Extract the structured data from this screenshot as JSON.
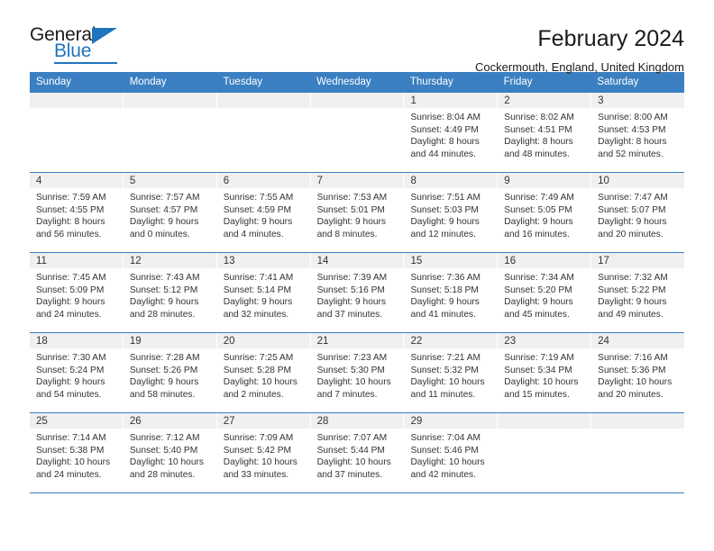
{
  "brand": {
    "name_top": "General",
    "name_bottom": "Blue",
    "accent_color": "#1f74bd"
  },
  "header": {
    "title": "February 2024",
    "subtitle": "Cockermouth, England, United Kingdom"
  },
  "theme": {
    "header_row_bg": "#3a7fc1",
    "date_band_bg": "#f0f0f0",
    "text_color": "#333333"
  },
  "weekdays": [
    "Sunday",
    "Monday",
    "Tuesday",
    "Wednesday",
    "Thursday",
    "Friday",
    "Saturday"
  ],
  "labels": {
    "sunrise": "Sunrise:",
    "sunset": "Sunset:",
    "daylight": "Daylight:"
  },
  "weeks": [
    [
      {
        "day": "",
        "empty": true
      },
      {
        "day": "",
        "empty": true
      },
      {
        "day": "",
        "empty": true
      },
      {
        "day": "",
        "empty": true
      },
      {
        "day": "1",
        "sunrise": "Sunrise: 8:04 AM",
        "sunset": "Sunset: 4:49 PM",
        "daylight1": "Daylight: 8 hours",
        "daylight2": "and 44 minutes."
      },
      {
        "day": "2",
        "sunrise": "Sunrise: 8:02 AM",
        "sunset": "Sunset: 4:51 PM",
        "daylight1": "Daylight: 8 hours",
        "daylight2": "and 48 minutes."
      },
      {
        "day": "3",
        "sunrise": "Sunrise: 8:00 AM",
        "sunset": "Sunset: 4:53 PM",
        "daylight1": "Daylight: 8 hours",
        "daylight2": "and 52 minutes."
      }
    ],
    [
      {
        "day": "4",
        "sunrise": "Sunrise: 7:59 AM",
        "sunset": "Sunset: 4:55 PM",
        "daylight1": "Daylight: 8 hours",
        "daylight2": "and 56 minutes."
      },
      {
        "day": "5",
        "sunrise": "Sunrise: 7:57 AM",
        "sunset": "Sunset: 4:57 PM",
        "daylight1": "Daylight: 9 hours",
        "daylight2": "and 0 minutes."
      },
      {
        "day": "6",
        "sunrise": "Sunrise: 7:55 AM",
        "sunset": "Sunset: 4:59 PM",
        "daylight1": "Daylight: 9 hours",
        "daylight2": "and 4 minutes."
      },
      {
        "day": "7",
        "sunrise": "Sunrise: 7:53 AM",
        "sunset": "Sunset: 5:01 PM",
        "daylight1": "Daylight: 9 hours",
        "daylight2": "and 8 minutes."
      },
      {
        "day": "8",
        "sunrise": "Sunrise: 7:51 AM",
        "sunset": "Sunset: 5:03 PM",
        "daylight1": "Daylight: 9 hours",
        "daylight2": "and 12 minutes."
      },
      {
        "day": "9",
        "sunrise": "Sunrise: 7:49 AM",
        "sunset": "Sunset: 5:05 PM",
        "daylight1": "Daylight: 9 hours",
        "daylight2": "and 16 minutes."
      },
      {
        "day": "10",
        "sunrise": "Sunrise: 7:47 AM",
        "sunset": "Sunset: 5:07 PM",
        "daylight1": "Daylight: 9 hours",
        "daylight2": "and 20 minutes."
      }
    ],
    [
      {
        "day": "11",
        "sunrise": "Sunrise: 7:45 AM",
        "sunset": "Sunset: 5:09 PM",
        "daylight1": "Daylight: 9 hours",
        "daylight2": "and 24 minutes."
      },
      {
        "day": "12",
        "sunrise": "Sunrise: 7:43 AM",
        "sunset": "Sunset: 5:12 PM",
        "daylight1": "Daylight: 9 hours",
        "daylight2": "and 28 minutes."
      },
      {
        "day": "13",
        "sunrise": "Sunrise: 7:41 AM",
        "sunset": "Sunset: 5:14 PM",
        "daylight1": "Daylight: 9 hours",
        "daylight2": "and 32 minutes."
      },
      {
        "day": "14",
        "sunrise": "Sunrise: 7:39 AM",
        "sunset": "Sunset: 5:16 PM",
        "daylight1": "Daylight: 9 hours",
        "daylight2": "and 37 minutes."
      },
      {
        "day": "15",
        "sunrise": "Sunrise: 7:36 AM",
        "sunset": "Sunset: 5:18 PM",
        "daylight1": "Daylight: 9 hours",
        "daylight2": "and 41 minutes."
      },
      {
        "day": "16",
        "sunrise": "Sunrise: 7:34 AM",
        "sunset": "Sunset: 5:20 PM",
        "daylight1": "Daylight: 9 hours",
        "daylight2": "and 45 minutes."
      },
      {
        "day": "17",
        "sunrise": "Sunrise: 7:32 AM",
        "sunset": "Sunset: 5:22 PM",
        "daylight1": "Daylight: 9 hours",
        "daylight2": "and 49 minutes."
      }
    ],
    [
      {
        "day": "18",
        "sunrise": "Sunrise: 7:30 AM",
        "sunset": "Sunset: 5:24 PM",
        "daylight1": "Daylight: 9 hours",
        "daylight2": "and 54 minutes."
      },
      {
        "day": "19",
        "sunrise": "Sunrise: 7:28 AM",
        "sunset": "Sunset: 5:26 PM",
        "daylight1": "Daylight: 9 hours",
        "daylight2": "and 58 minutes."
      },
      {
        "day": "20",
        "sunrise": "Sunrise: 7:25 AM",
        "sunset": "Sunset: 5:28 PM",
        "daylight1": "Daylight: 10 hours",
        "daylight2": "and 2 minutes."
      },
      {
        "day": "21",
        "sunrise": "Sunrise: 7:23 AM",
        "sunset": "Sunset: 5:30 PM",
        "daylight1": "Daylight: 10 hours",
        "daylight2": "and 7 minutes."
      },
      {
        "day": "22",
        "sunrise": "Sunrise: 7:21 AM",
        "sunset": "Sunset: 5:32 PM",
        "daylight1": "Daylight: 10 hours",
        "daylight2": "and 11 minutes."
      },
      {
        "day": "23",
        "sunrise": "Sunrise: 7:19 AM",
        "sunset": "Sunset: 5:34 PM",
        "daylight1": "Daylight: 10 hours",
        "daylight2": "and 15 minutes."
      },
      {
        "day": "24",
        "sunrise": "Sunrise: 7:16 AM",
        "sunset": "Sunset: 5:36 PM",
        "daylight1": "Daylight: 10 hours",
        "daylight2": "and 20 minutes."
      }
    ],
    [
      {
        "day": "25",
        "sunrise": "Sunrise: 7:14 AM",
        "sunset": "Sunset: 5:38 PM",
        "daylight1": "Daylight: 10 hours",
        "daylight2": "and 24 minutes."
      },
      {
        "day": "26",
        "sunrise": "Sunrise: 7:12 AM",
        "sunset": "Sunset: 5:40 PM",
        "daylight1": "Daylight: 10 hours",
        "daylight2": "and 28 minutes."
      },
      {
        "day": "27",
        "sunrise": "Sunrise: 7:09 AM",
        "sunset": "Sunset: 5:42 PM",
        "daylight1": "Daylight: 10 hours",
        "daylight2": "and 33 minutes."
      },
      {
        "day": "28",
        "sunrise": "Sunrise: 7:07 AM",
        "sunset": "Sunset: 5:44 PM",
        "daylight1": "Daylight: 10 hours",
        "daylight2": "and 37 minutes."
      },
      {
        "day": "29",
        "sunrise": "Sunrise: 7:04 AM",
        "sunset": "Sunset: 5:46 PM",
        "daylight1": "Daylight: 10 hours",
        "daylight2": "and 42 minutes."
      },
      {
        "day": "",
        "empty": true
      },
      {
        "day": "",
        "empty": true
      }
    ]
  ]
}
